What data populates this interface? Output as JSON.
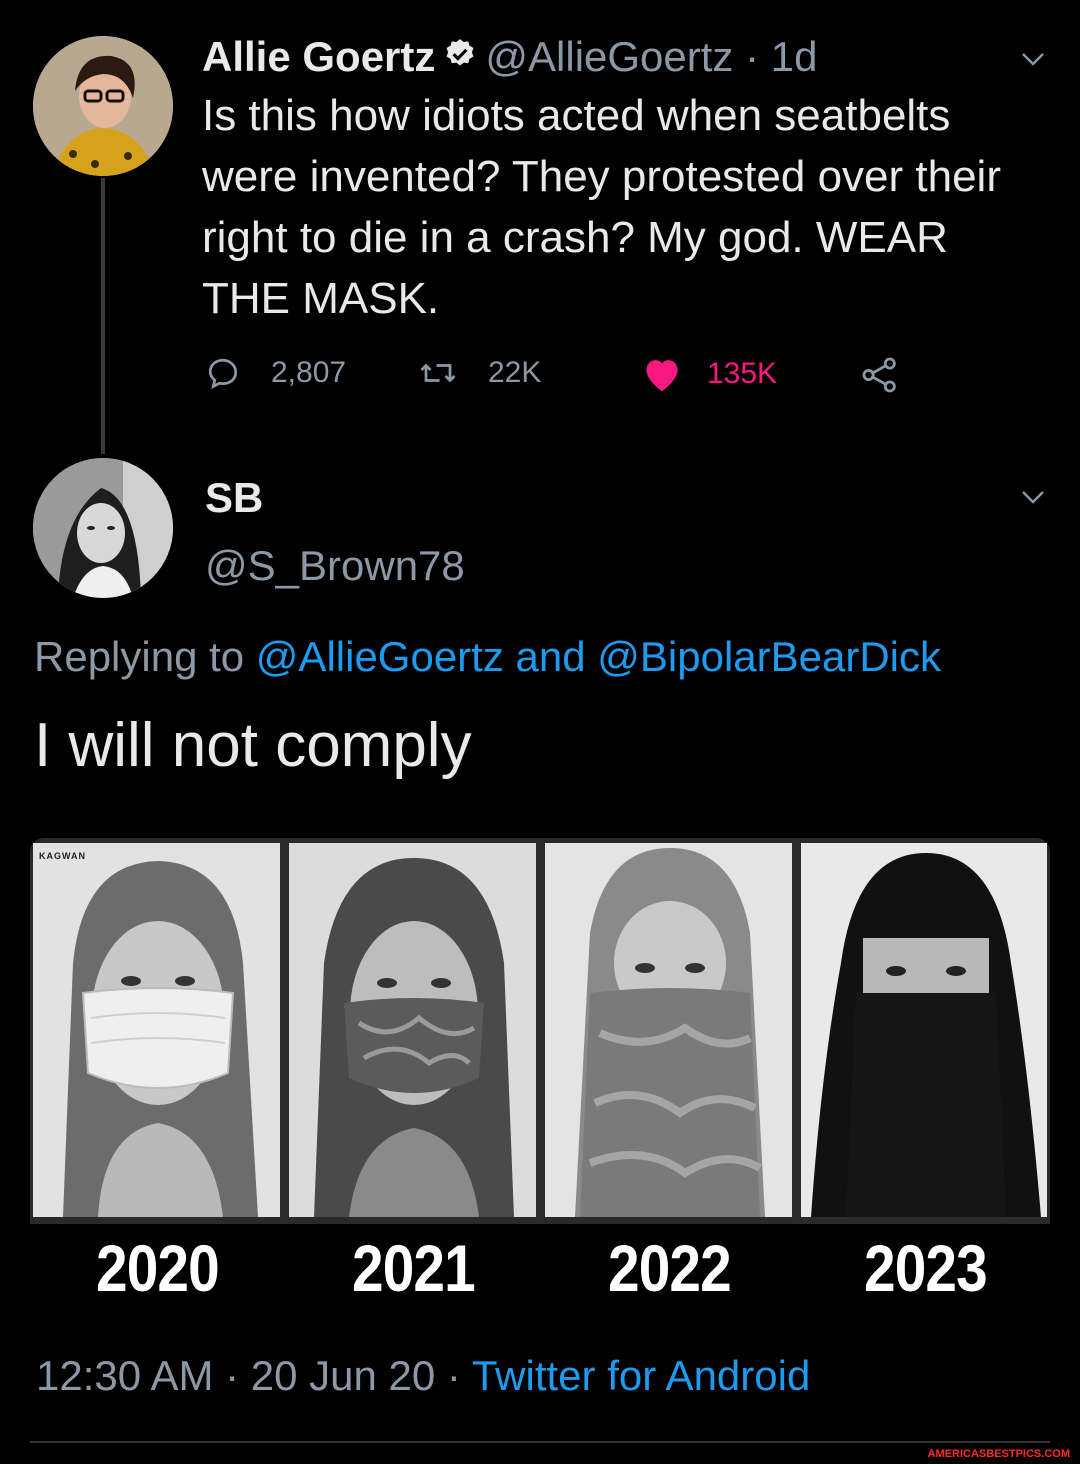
{
  "tweet": {
    "author_name": "Allie Goertz",
    "handle_time": "@AllieGoertz · 1d",
    "text": "Is this how idiots acted when seatbelts were invented? They protested over their right to die in a crash? My god. WEAR THE MASK.",
    "replies": "2,807",
    "retweets": "22K",
    "likes": "135K",
    "verified": true
  },
  "reply": {
    "author_name": "SB",
    "handle": "@S_Brown78",
    "replying_prefix": "Replying to",
    "replying_user1": "@AllieGoertz",
    "replying_and": "and",
    "replying_user2": "@BipolarBearDick",
    "text": "I will not comply",
    "image": {
      "years": [
        "2020",
        "2021",
        "2022",
        "2023"
      ],
      "logo_text": "KAGWAN"
    },
    "timestamp": "12:30 AM · 20 Jun 20 ·",
    "client": "Twitter for Android"
  },
  "colors": {
    "background": "#000000",
    "accent": "#1d9bf0",
    "like": "#f91880",
    "muted": "#8b98a5"
  },
  "watermark": "AMERICASBESTPICS.COM"
}
